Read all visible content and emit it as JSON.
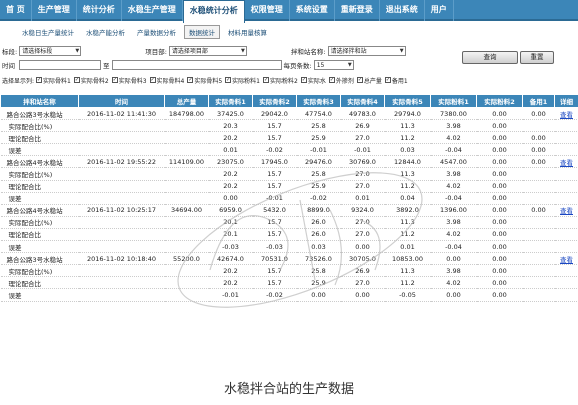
{
  "nav": {
    "tabs": [
      "首 页",
      "生产管理",
      "统计分析",
      "水稳生产管理",
      "水稳统计分析",
      "权限管理",
      "系统设置",
      "重新登录",
      "退出系统",
      "用户"
    ],
    "active_index": 4
  },
  "subnav": {
    "tabs": [
      "水稳日生产量统计",
      "水稳产能分析",
      "产量数据分析",
      "数据统计",
      "材料用量核算"
    ],
    "active_index": 3
  },
  "filters": {
    "mark_label": "标段:",
    "mark_value": "请选择标段",
    "project_label": "项目部:",
    "project_value": "请选择项目部",
    "station_label": "拌和站名称:",
    "station_value": "请选择拌和站",
    "time_label": "时间",
    "to_label": "至",
    "pagesize_label": "每页条数:",
    "pagesize_value": "15",
    "query_btn": "查询",
    "reset_btn": "重置"
  },
  "options": {
    "select_label": "选择显示列:",
    "columns": [
      "实际骨料1",
      "实际骨料2",
      "实际骨料3",
      "实际骨料4",
      "实际骨料5",
      "实际粉料1",
      "实际粉料2",
      "实际水",
      "外掺剂",
      "总产量",
      "备用1"
    ]
  },
  "table": {
    "headers": [
      "拌和站名称",
      "时间",
      "总产量",
      "实际骨料1",
      "实际骨料2",
      "实际骨料3",
      "实际骨料4",
      "实际骨料5",
      "实际粉料1",
      "实际粉料2",
      "备用1",
      "详细"
    ],
    "rows": [
      {
        "kind": "main",
        "cells": [
          "路合公路3号水稳站",
          "2016-11-02 11:41:30",
          "184798.00",
          "37425.0",
          "29042.0",
          "47754.0",
          "49783.0",
          "29794.0",
          "7380.00",
          "0.00",
          "0.00",
          "查看"
        ]
      },
      {
        "kind": "sub",
        "cells": [
          "实际配合比(%)",
          "",
          "",
          "20.3",
          "15.7",
          "25.8",
          "26.9",
          "11.3",
          "3.98",
          "0.00",
          ""
        ]
      },
      {
        "kind": "sub",
        "cells": [
          "理论配合比",
          "",
          "",
          "20.2",
          "15.7",
          "25.9",
          "27.0",
          "11.2",
          "4.02",
          "0.00",
          "0.00"
        ]
      },
      {
        "kind": "sub",
        "cells": [
          "误差",
          "",
          "",
          "0.01",
          "-0.02",
          "-0.01",
          "-0.01",
          "0.03",
          "-0.04",
          "0.00",
          "0.00"
        ]
      },
      {
        "kind": "main",
        "cells": [
          "路合公路4号水稳站",
          "2016-11-02 19:55:22",
          "114109.00",
          "23075.0",
          "17945.0",
          "29476.0",
          "30769.0",
          "12844.0",
          "4547.00",
          "0.00",
          "0.00",
          "查看"
        ]
      },
      {
        "kind": "sub",
        "cells": [
          "实际配合比(%)",
          "",
          "",
          "20.2",
          "15.7",
          "25.8",
          "27.0",
          "11.3",
          "3.98",
          "0.00",
          ""
        ]
      },
      {
        "kind": "sub",
        "cells": [
          "理论配合比",
          "",
          "",
          "20.2",
          "15.7",
          "25.9",
          "27.0",
          "11.2",
          "4.02",
          "0.00",
          ""
        ]
      },
      {
        "kind": "sub",
        "cells": [
          "误差",
          "",
          "",
          "0.00",
          "-0.01",
          "-0.02",
          "0.01",
          "0.04",
          "-0.04",
          "0.00",
          ""
        ]
      },
      {
        "kind": "main",
        "cells": [
          "路合公路4号水稳站",
          "2016-11-02 10:25:17",
          "34694.00",
          "6959.0",
          "5432.0",
          "8899.0",
          "9324.0",
          "3892.0",
          "1396.00",
          "0.00",
          "0.00",
          "查看"
        ]
      },
      {
        "kind": "sub",
        "cells": [
          "实际配合比(%)",
          "",
          "",
          "20.1",
          "15.7",
          "26.0",
          "27.0",
          "11.3",
          "3.98",
          "0.00",
          ""
        ]
      },
      {
        "kind": "sub",
        "cells": [
          "理论配合比",
          "",
          "",
          "20.1",
          "15.7",
          "26.0",
          "27.0",
          "11.2",
          "4.02",
          "0.00",
          ""
        ]
      },
      {
        "kind": "sub",
        "cells": [
          "误差",
          "",
          "",
          "-0.03",
          "-0.03",
          "0.03",
          "0.00",
          "0.01",
          "-0.04",
          "0.00",
          ""
        ]
      },
      {
        "kind": "main",
        "cells": [
          "路合公路3号水稳站",
          "2016-11-02 10:18:40",
          "55200.0",
          "42674.0",
          "70531.0",
          "73526.0",
          "30705.0",
          "10853.00",
          "0.00",
          "0.00",
          "",
          "查看"
        ]
      },
      {
        "kind": "sub",
        "cells": [
          "实际配合比(%)",
          "",
          "",
          "20.2",
          "15.7",
          "25.8",
          "26.9",
          "11.3",
          "3.98",
          "0.00",
          ""
        ]
      },
      {
        "kind": "sub",
        "cells": [
          "理论配合比",
          "",
          "",
          "20.2",
          "15.7",
          "25.9",
          "27.0",
          "11.2",
          "4.02",
          "0.00",
          ""
        ]
      },
      {
        "kind": "sub",
        "cells": [
          "误差",
          "",
          "",
          "-0.01",
          "-0.02",
          "0.00",
          "0.00",
          "-0.05",
          "0.00",
          "0.00",
          ""
        ]
      }
    ]
  },
  "caption": "水稳拌合站的生产数据",
  "colors": {
    "header": "#3c86b8",
    "link": "#1a47c2"
  }
}
